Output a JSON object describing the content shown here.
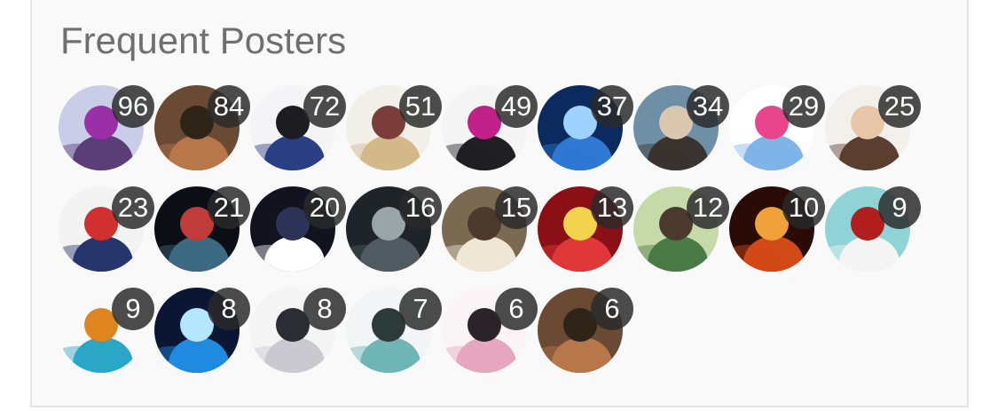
{
  "widget": {
    "title": "Frequent Posters"
  },
  "posters": [
    {
      "count": "96",
      "avatar": "armored-knight-avatar",
      "colors": [
        "#c9cde8",
        "#5b3d78",
        "#9b2fa8"
      ]
    },
    {
      "count": "84",
      "avatar": "painting-scene-avatar",
      "colors": [
        "#6b4a33",
        "#b8774a",
        "#2e2418"
      ]
    },
    {
      "count": "72",
      "avatar": "anime-boy-blue-hair-avatar",
      "colors": [
        "#f4f4f6",
        "#2b3f84",
        "#1c1c22"
      ]
    },
    {
      "count": "51",
      "avatar": "blonde-knight-avatar",
      "colors": [
        "#f2efe9",
        "#d3b889",
        "#7b3d3a"
      ]
    },
    {
      "count": "49",
      "avatar": "black-cat-avatar",
      "colors": [
        "#f4f4f4",
        "#1f1f24",
        "#c02088"
      ]
    },
    {
      "count": "37",
      "avatar": "blue-warrior-avatar",
      "colors": [
        "#0b2a5e",
        "#2f78d4",
        "#9ed2ff"
      ]
    },
    {
      "count": "34",
      "avatar": "man-in-suit-avatar",
      "colors": [
        "#6f8fa6",
        "#3a3431",
        "#d9c7b0"
      ]
    },
    {
      "count": "29",
      "avatar": "totoro-doodle-avatar",
      "colors": [
        "#ffffff",
        "#7fb4e8",
        "#e8458d"
      ]
    },
    {
      "count": "25",
      "avatar": "smiling-woman-avatar",
      "colors": [
        "#f3f0ec",
        "#5a3e2f",
        "#e7c6a8"
      ]
    },
    {
      "count": "23",
      "avatar": "lawyer-blue-suit-avatar",
      "colors": [
        "#f3f3f3",
        "#27356d",
        "#d13030"
      ]
    },
    {
      "count": "21",
      "avatar": "dark-orb-avatar",
      "colors": [
        "#0b0e15",
        "#3c6a82",
        "#c23b3b"
      ]
    },
    {
      "count": "20",
      "avatar": "sl-logo-avatar",
      "colors": [
        "#11131f",
        "#ffffff",
        "#2d3356"
      ]
    },
    {
      "count": "16",
      "avatar": "werewolf-avatar",
      "colors": [
        "#1e2428",
        "#4f5b61",
        "#9aa5aa"
      ]
    },
    {
      "count": "15",
      "avatar": "chef-man-avatar",
      "colors": [
        "#7b6a52",
        "#efe6d6",
        "#4c3b2c"
      ]
    },
    {
      "count": "13",
      "avatar": "red-dragon-avatar",
      "colors": [
        "#8a1016",
        "#e0383a",
        "#f3d24d"
      ]
    },
    {
      "count": "12",
      "avatar": "green-coat-man-avatar",
      "colors": [
        "#c6d9a8",
        "#4a7a45",
        "#4b3a2e"
      ]
    },
    {
      "count": "10",
      "avatar": "fire-creature-avatar",
      "colors": [
        "#2a0b06",
        "#d24a17",
        "#f0a13a"
      ]
    },
    {
      "count": "9",
      "avatar": "white-bear-avatar",
      "colors": [
        "#8fd3d6",
        "#f4f4f4",
        "#b21e1e"
      ]
    },
    {
      "count": "9",
      "avatar": "pirate-mask-avatar",
      "colors": [
        "#f9f9f9",
        "#2aa7c7",
        "#e0841f"
      ]
    },
    {
      "count": "8",
      "avatar": "glowing-hands-avatar",
      "colors": [
        "#0a1633",
        "#1f8be0",
        "#b4e6ff"
      ]
    },
    {
      "count": "8",
      "avatar": "silver-hair-boy-avatar",
      "colors": [
        "#f4f4f4",
        "#c9c9cf",
        "#2c2c33"
      ]
    },
    {
      "count": "7",
      "avatar": "sketch-man-avatar",
      "colors": [
        "#f2f5f5",
        "#6fb5b5",
        "#2c3a3a"
      ]
    },
    {
      "count": "6",
      "avatar": "pink-hair-girl-avatar",
      "colors": [
        "#faf4f6",
        "#e6a6bd",
        "#2b2329"
      ]
    },
    {
      "count": "6",
      "avatar": "painting-scene-avatar",
      "colors": [
        "#6b4a33",
        "#b8774a",
        "#2e2418"
      ]
    }
  ]
}
